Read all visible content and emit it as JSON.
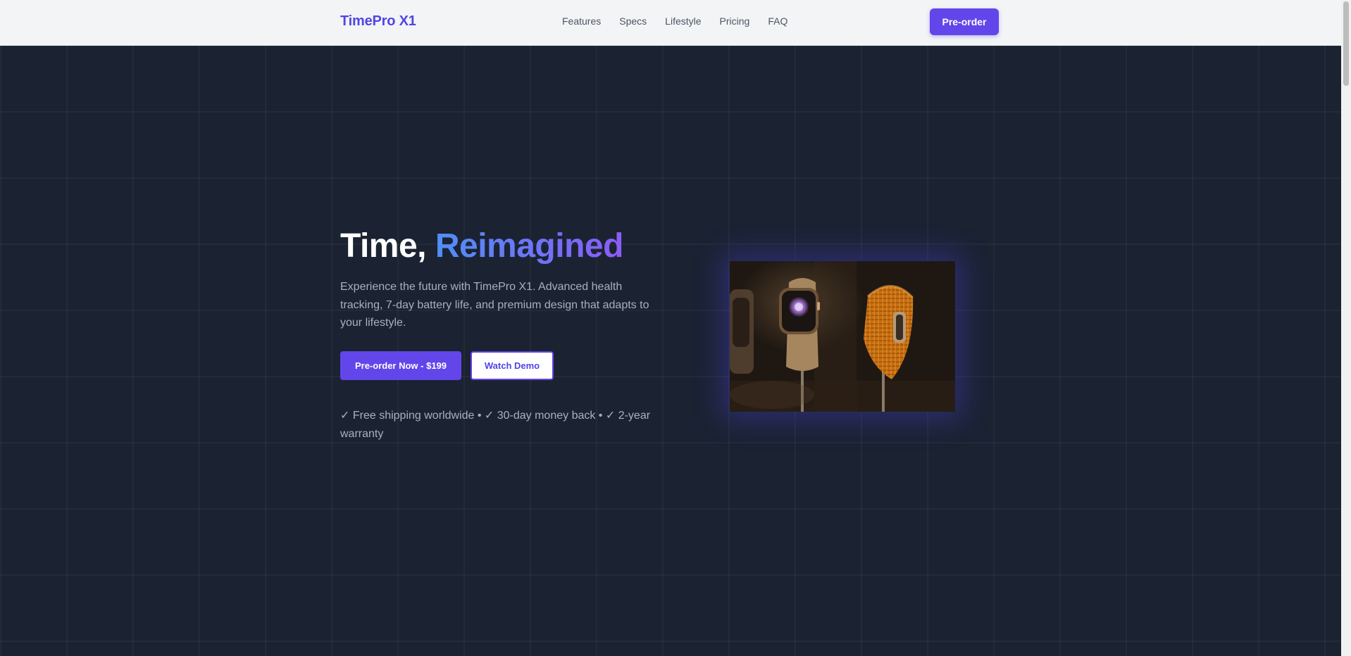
{
  "nav": {
    "brand": "TimePro X1",
    "links": [
      "Features",
      "Specs",
      "Lifestyle",
      "Pricing",
      "FAQ"
    ],
    "cta": "Pre-order"
  },
  "hero": {
    "title_lead": "Time,",
    "title_accent": "Reimagined",
    "description": "Experience the future with TimePro X1. Advanced health tracking, 7-day battery life, and premium design that adapts to your lifestyle.",
    "primary_button": "Pre-order Now - $199",
    "secondary_button": "Watch Demo",
    "perks": "✓ Free shipping worldwide • ✓ 30-day money back • ✓ 2-year warranty"
  },
  "colors": {
    "accent": "#6246ea",
    "brand": "#4f46e5",
    "background": "#1b2232",
    "gradient_start": "#4f8ff5",
    "gradient_end": "#8b5cf6"
  }
}
